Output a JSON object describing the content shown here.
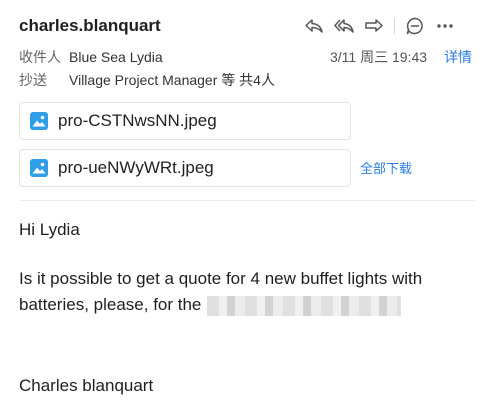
{
  "header": {
    "sender": "charles.blanquart",
    "to_label": "收件人",
    "to_value": "Blue Sea Lydia",
    "cc_label": "抄送",
    "cc_value": "Village Project Manager 等 共4人",
    "date": "3/11 周三 19:43",
    "detail_link": "详情"
  },
  "actions": {
    "icons": [
      "reply-icon",
      "reply-all-icon",
      "forward-icon",
      "chat-icon",
      "more-icon"
    ]
  },
  "attachments": [
    {
      "name": "pro-CSTNwsNN.jpeg"
    },
    {
      "name": "pro-ueNWyWRt.jpeg"
    }
  ],
  "download_all": "全部下载",
  "body": {
    "greeting": "Hi Lydia",
    "paragraph": "Is it possible to get a quote for 4 new buffet lights with batteries, please, for the",
    "signature": "Charles blanquart"
  },
  "colors": {
    "accent": "#2a7de1",
    "file_icon": "#2f9ee8"
  }
}
